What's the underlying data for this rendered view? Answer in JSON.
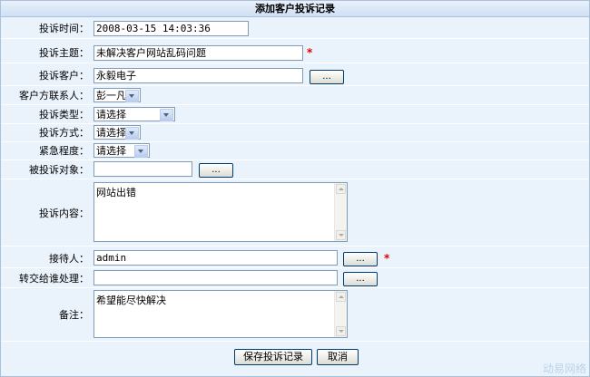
{
  "title": "添加客户投诉记录",
  "fields": {
    "time": {
      "label": "投诉时间：",
      "value": "2008-03-15 14:03:36"
    },
    "subject": {
      "label": "投诉主题：",
      "value": "未解决客户网站乱码问题"
    },
    "customer": {
      "label": "投诉客户：",
      "value": "永毅电子",
      "button": "..."
    },
    "contact": {
      "label": "客户方联系人：",
      "value": "彭一凡"
    },
    "type": {
      "label": "投诉类型：",
      "value": "请选择"
    },
    "method": {
      "label": "投诉方式：",
      "value": "请选择"
    },
    "urgency": {
      "label": "紧急程度：",
      "value": "请选择"
    },
    "target": {
      "label": "被投诉对象：",
      "value": "",
      "button": "..."
    },
    "content": {
      "label": "投诉内容：",
      "value": "网站出错"
    },
    "receiver": {
      "label": "接待人：",
      "value": "admin",
      "button": "..."
    },
    "transfer": {
      "label": "转交给谁处理：",
      "value": "",
      "button": "..."
    },
    "remark": {
      "label": "备注：",
      "value": "希望能尽快解决"
    }
  },
  "required_mark": "*",
  "buttons": {
    "save": "保存投诉记录",
    "cancel": "取消"
  },
  "watermark": "动易网络"
}
